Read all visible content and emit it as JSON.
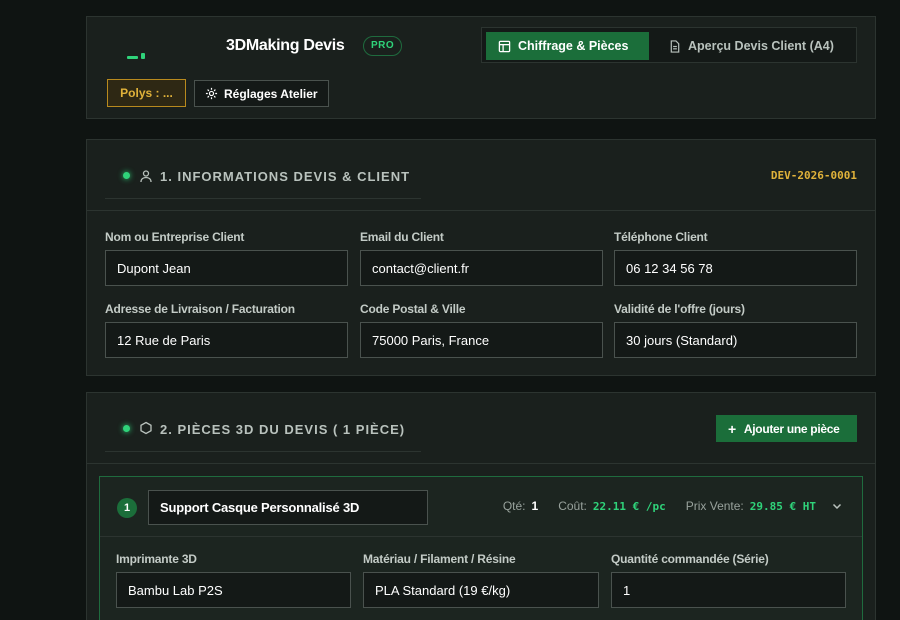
{
  "header": {
    "brand": "3DMaking Devis",
    "badge": "PRO",
    "tabs": [
      {
        "label": "Chiffrage & Pièces",
        "icon": "layout-icon",
        "active": true
      },
      {
        "label": "Aperçu Devis Client (A4)",
        "icon": "document-icon",
        "active": false
      }
    ],
    "polys_label": "Polys : ...",
    "settings_label": "Réglages Atelier"
  },
  "section1": {
    "title": "1. INFORMATIONS DEVIS & CLIENT",
    "icon": "user-icon",
    "devis_code": "DEV-2026-0001",
    "fields": [
      {
        "label": "Nom ou Entreprise Client",
        "value": "Dupont Jean"
      },
      {
        "label": "Email du Client",
        "value": "contact@client.fr"
      },
      {
        "label": "Téléphone Client",
        "value": "06 12 34 56 78"
      },
      {
        "label": "Adresse de Livraison / Facturation",
        "value": "12 Rue de Paris"
      },
      {
        "label": "Code Postal & Ville",
        "value": "75000 Paris, France"
      },
      {
        "label": "Validité de l'offre (jours)",
        "value": "30 jours (Standard)"
      }
    ]
  },
  "section2": {
    "title": "2. PIÈCES 3D DU DEVIS ( 1 PIÈCE)",
    "icon": "hexagon-icon",
    "add_label": "Ajouter une pièce",
    "piece": {
      "number": "1",
      "name": "Support Casque Personnalisé 3D",
      "qty_label": "Qté:",
      "qty_value": "1",
      "cost_label": "Coût:",
      "cost_value": "22.11 € /pc",
      "price_label": "Prix Vente:",
      "price_value": "29.85 € HT",
      "fields": [
        {
          "label": "Imprimante 3D",
          "value": "Bambu Lab P2S"
        },
        {
          "label": "Matériau / Filament / Résine",
          "value": "PLA Standard (19 €/kg)"
        },
        {
          "label": "Quantité commandée (Série)",
          "value": "1"
        }
      ]
    }
  },
  "colors": {
    "accent_green": "#2fd37a",
    "button_green": "#1b6e3a",
    "warning_gold": "#e0b23a",
    "background": "#0f1412"
  }
}
